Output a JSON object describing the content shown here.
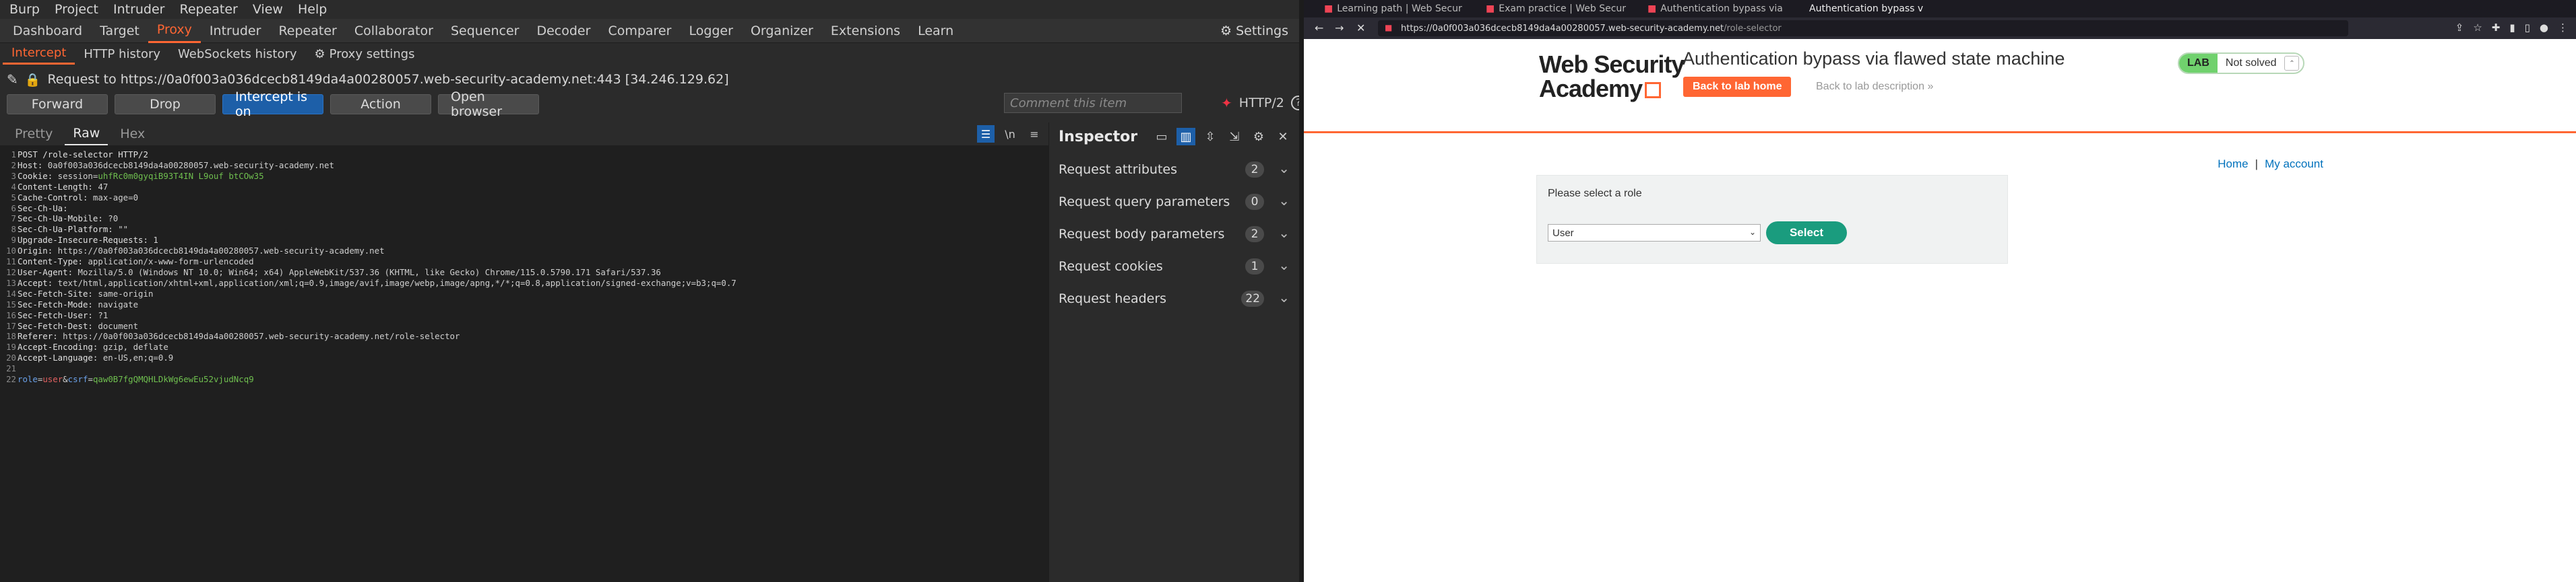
{
  "burp": {
    "menu": [
      "Burp",
      "Project",
      "Intruder",
      "Repeater",
      "View",
      "Help"
    ],
    "tabs": [
      "Dashboard",
      "Target",
      "Proxy",
      "Intruder",
      "Repeater",
      "Collaborator",
      "Sequencer",
      "Decoder",
      "Comparer",
      "Logger",
      "Organizer",
      "Extensions",
      "Learn"
    ],
    "active_tab": "Proxy",
    "settings_label": "Settings",
    "subtabs": [
      "Intercept",
      "HTTP history",
      "WebSockets history"
    ],
    "active_subtab": "Intercept",
    "proxy_settings_label": "Proxy settings",
    "request_line": "Request to https://0a0f003a036dcecb8149da4a00280057.web-security-academy.net:443  [34.246.129.62]",
    "buttons": {
      "forward": "Forward",
      "drop": "Drop",
      "intercept": "Intercept is on",
      "action": "Action",
      "open_browser": "Open browser"
    },
    "comment_placeholder": "Comment this item",
    "http_version": "HTTP/2",
    "editor_tabs": [
      "Pretty",
      "Raw",
      "Hex"
    ],
    "active_editor_tab": "Raw",
    "newline_toggle": "\\n",
    "request_lines": [
      {
        "n": "1",
        "k": "POST /role-selector HTTP/2",
        "v": ""
      },
      {
        "n": "2",
        "k": "Host:",
        "v": " 0a0f003a036dcecb8149da4a00280057.web-security-academy.net"
      },
      {
        "n": "3",
        "k": "Cookie:",
        "v": " session=",
        "c": "uhfRc0m0gyqiB93T4IN L9ouf btCOw35"
      },
      {
        "n": "4",
        "k": "Content-Length:",
        "v": " 47"
      },
      {
        "n": "5",
        "k": "Cache-Control:",
        "v": " max-age=0"
      },
      {
        "n": "6",
        "k": "Sec-Ch-Ua:",
        "v": ""
      },
      {
        "n": "7",
        "k": "Sec-Ch-Ua-Mobile:",
        "v": " ?0"
      },
      {
        "n": "8",
        "k": "Sec-Ch-Ua-Platform:",
        "v": " \"\""
      },
      {
        "n": "9",
        "k": "Upgrade-Insecure-Requests:",
        "v": " 1"
      },
      {
        "n": "10",
        "k": "Origin:",
        "v": " https://0a0f003a036dcecb8149da4a00280057.web-security-academy.net"
      },
      {
        "n": "11",
        "k": "Content-Type:",
        "v": " application/x-www-form-urlencoded"
      },
      {
        "n": "12",
        "k": "User-Agent:",
        "v": " Mozilla/5.0 (Windows NT 10.0; Win64; x64) AppleWebKit/537.36 (KHTML, like Gecko) Chrome/115.0.5790.171 Safari/537.36"
      },
      {
        "n": "13",
        "k": "Accept:",
        "v": " text/html,application/xhtml+xml,application/xml;q=0.9,image/avif,image/webp,image/apng,*/*;q=0.8,application/signed-exchange;v=b3;q=0.7"
      },
      {
        "n": "14",
        "k": "Sec-Fetch-Site:",
        "v": " same-origin"
      },
      {
        "n": "15",
        "k": "Sec-Fetch-Mode:",
        "v": " navigate"
      },
      {
        "n": "16",
        "k": "Sec-Fetch-User:",
        "v": " ?1"
      },
      {
        "n": "17",
        "k": "Sec-Fetch-Dest:",
        "v": " document"
      },
      {
        "n": "18",
        "k": "Referer:",
        "v": " https://0a0f003a036dcecb8149da4a00280057.web-security-academy.net/role-selector"
      },
      {
        "n": "19",
        "k": "Accept-Encoding:",
        "v": " gzip, deflate"
      },
      {
        "n": "20",
        "k": "Accept-Language:",
        "v": " en-US,en;q=0.9"
      },
      {
        "n": "21",
        "k": "",
        "v": ""
      }
    ],
    "body_line": {
      "n": "22",
      "p1": "role",
      "v1": "user",
      "p2": "csrf",
      "v2": "qaw0B7fgQMQHLDkWg6ewEu52vjudNcq9"
    },
    "inspector": {
      "title": "Inspector",
      "sections": [
        {
          "label": "Request attributes",
          "count": "2"
        },
        {
          "label": "Request query parameters",
          "count": "0"
        },
        {
          "label": "Request body parameters",
          "count": "2"
        },
        {
          "label": "Request cookies",
          "count": "1"
        },
        {
          "label": "Request headers",
          "count": "22"
        }
      ]
    }
  },
  "browser": {
    "tab_titles": [
      "Learning path | Web Secur",
      "Exam practice | Web Secur",
      "Authentication bypass via",
      "Authentication bypass v"
    ],
    "url_main": "https://0a0f003a036dcecb8149da4a00280057.web-security-academy.net",
    "url_path": "/role-selector",
    "logo_line1": "Web Security",
    "logo_line2": "Academy",
    "lab_title": "Authentication bypass via flawed state machine",
    "back_home": "Back to lab home",
    "back_desc": "Back to lab description",
    "lab_badge": "LAB",
    "lab_status": "Not solved",
    "nav_home": "Home",
    "nav_sep": "|",
    "nav_account": "My account",
    "form_label": "Please select a role",
    "select_value": "User",
    "submit_label": "Select",
    "colors": {
      "accent": "#ff6633",
      "submit": "#1a9c7e",
      "lab_green": "#70d16d"
    }
  }
}
